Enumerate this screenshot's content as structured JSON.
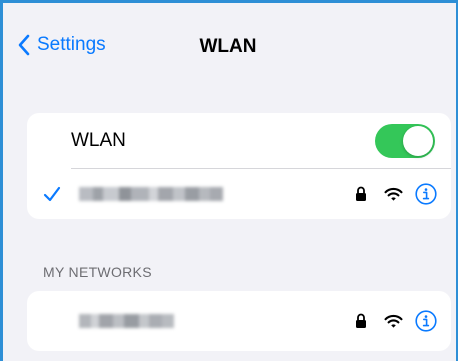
{
  "nav": {
    "back_label": "Settings",
    "title": "WLAN"
  },
  "wlan_toggle": {
    "label": "WLAN",
    "state": "on",
    "color": "#34c759"
  },
  "connected_network": {
    "ssid": "",
    "secured": true,
    "icons": [
      "checkmark-icon",
      "lock-icon",
      "wifi-icon",
      "info-icon"
    ]
  },
  "my_networks": {
    "header": "MY NETWORKS",
    "items": [
      {
        "ssid": "",
        "secured": true,
        "icons": [
          "lock-icon",
          "wifi-icon",
          "info-icon"
        ]
      }
    ]
  },
  "colors": {
    "accent": "#0a7aff",
    "background": "#f2f2f7",
    "card": "#ffffff",
    "frame_border": "#2e8fd6"
  }
}
